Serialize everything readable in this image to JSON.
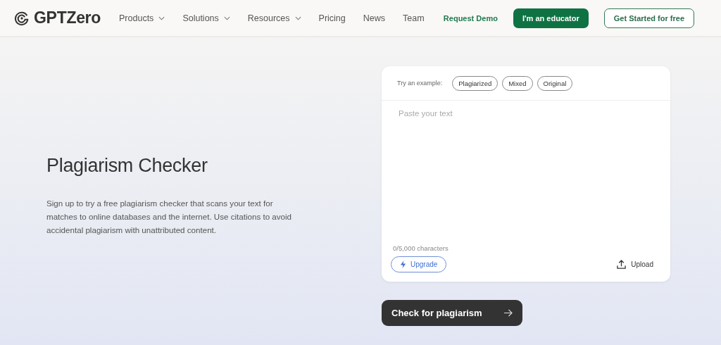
{
  "header": {
    "logo": "GPTZero",
    "nav": [
      {
        "label": "Products",
        "has_menu": true
      },
      {
        "label": "Solutions",
        "has_menu": true
      },
      {
        "label": "Resources",
        "has_menu": true
      },
      {
        "label": "Pricing",
        "has_menu": false
      },
      {
        "label": "News",
        "has_menu": false
      },
      {
        "label": "Team",
        "has_menu": false
      }
    ],
    "actions": [
      {
        "label": "Request Demo",
        "kind": "link"
      },
      {
        "label": "I'm an educator",
        "kind": "primary"
      },
      {
        "label": "Get Started for free",
        "kind": "outline"
      }
    ]
  },
  "hero": {
    "title": "Plagiarism Checker",
    "description": "Sign up to try a free plagiarism checker that scans your text for matches to online databases and the internet. Use citations to avoid accidental plagiarism with unattributed content."
  },
  "checker": {
    "examples_label": "Try an example:",
    "examples": [
      "Plagiarized",
      "Mixed",
      "Original"
    ],
    "placeholder": "Paste your text",
    "counter": "0/5,000 characters",
    "upgrade": "Upgrade",
    "upload": "Upload",
    "submit": "Check for plagiarism"
  }
}
